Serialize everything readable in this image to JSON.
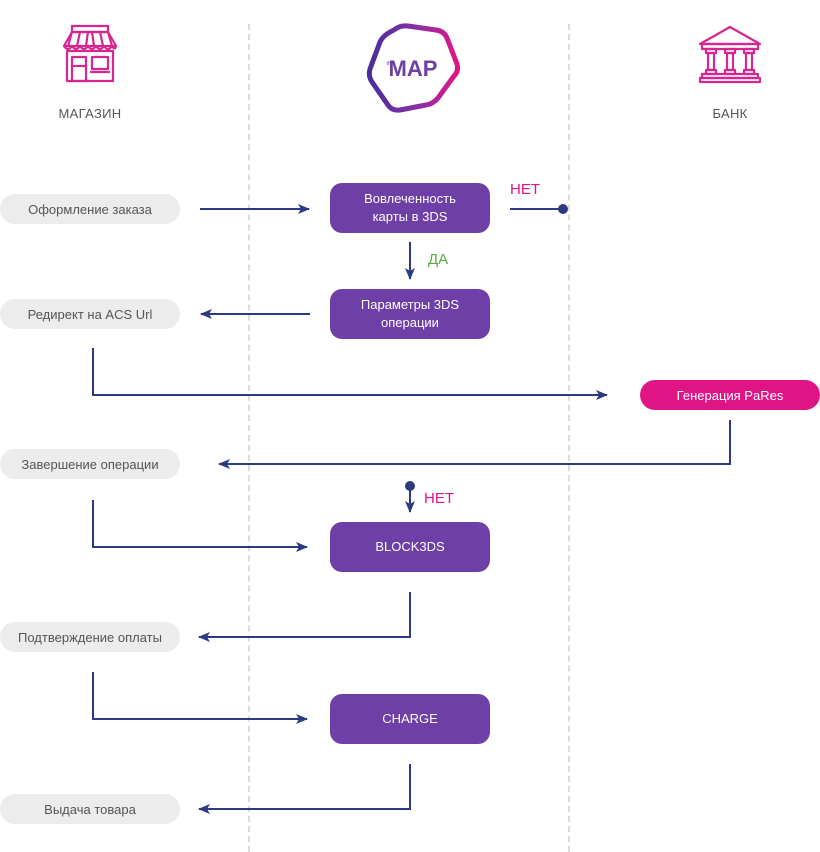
{
  "actors": {
    "shop": {
      "label": "МАГАЗИН",
      "icon": "storefront-icon"
    },
    "gateway": {
      "logo_text": "MAP",
      "logo_small": "the",
      "icon": "hexagon-logo-icon"
    },
    "bank": {
      "label": "БАНК",
      "icon": "bank-building-icon"
    }
  },
  "shop_steps": [
    {
      "label": "Оформление заказа"
    },
    {
      "label": "Редирект на ACS Url"
    },
    {
      "label": "Завершение операции"
    },
    {
      "label": "Подтверждение оплаты"
    },
    {
      "label": "Выдача товара"
    }
  ],
  "gateway_steps": [
    {
      "label_line1": "Вовлеченность",
      "label_line2": "карты в 3DS"
    },
    {
      "label_line1": "Параметры 3DS",
      "label_line2": "операции"
    },
    {
      "label_line1": "BLOCK3DS",
      "label_line2": ""
    },
    {
      "label_line1": "CHARGE",
      "label_line2": ""
    }
  ],
  "bank_steps": [
    {
      "label": "Генерация PaRes"
    }
  ],
  "branch_labels": {
    "no_top": "НЕТ",
    "yes": "ДА",
    "no_bottom": "НЕТ"
  },
  "colors": {
    "gateway_box": "#6f3fa8",
    "bank_box": "#e01585",
    "arrow": "#2b3a82",
    "no_label": "#e01585",
    "yes_label": "#5aac44",
    "icon": "#d6268f"
  }
}
